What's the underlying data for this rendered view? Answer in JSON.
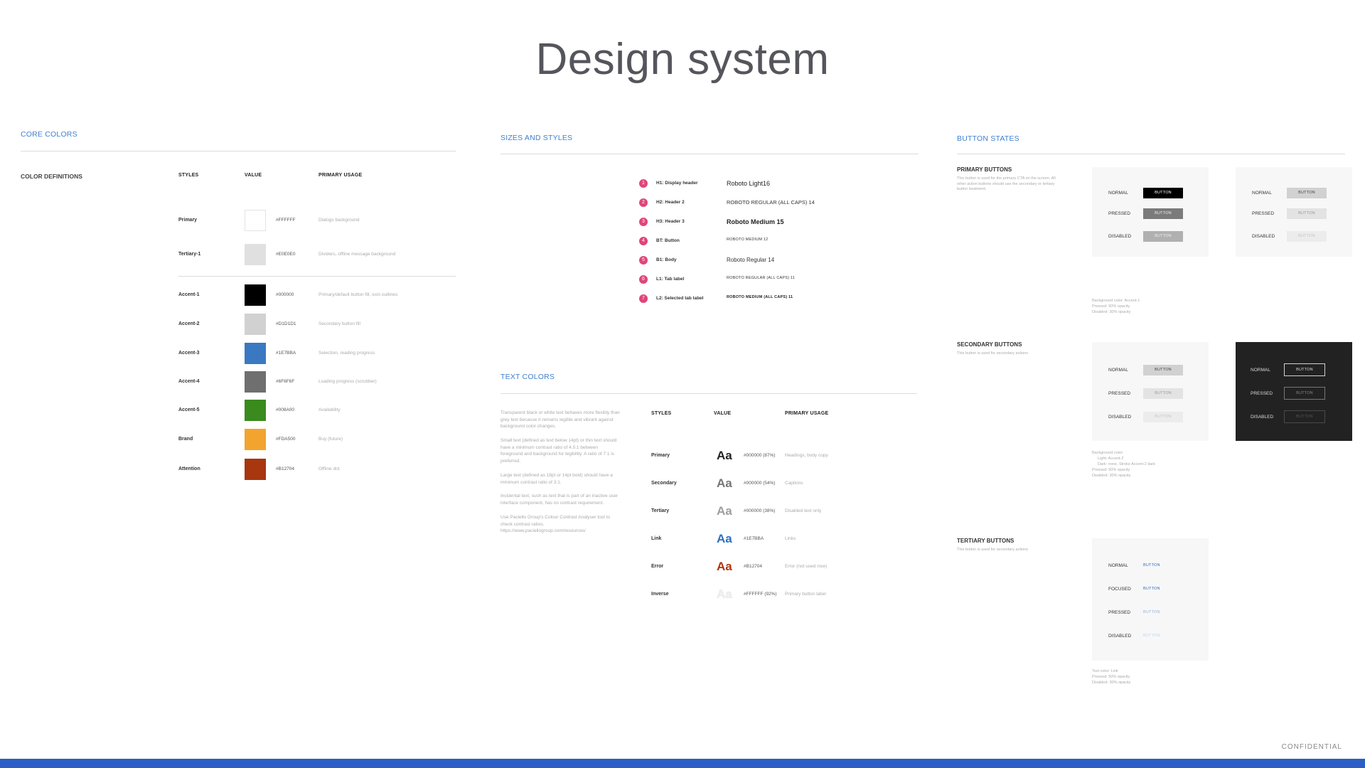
{
  "page_title": "Design system",
  "confidential": "CONFIDENTIAL",
  "core_colors": {
    "title": "CORE COLORS",
    "definitions_label": "COLOR DEFINITIONS",
    "headers": {
      "styles": "STYLES",
      "value": "VALUE",
      "usage": "PRIMARY USAGE"
    },
    "rows": [
      {
        "style": "Primary",
        "value": "#FFFFFF",
        "usage": "Dialogs background",
        "color": "#FFFFFF"
      },
      {
        "style": "Tertiary-1",
        "value": "#E0E0E0",
        "usage": "Dividers, offline message background",
        "color": "#E0E0E0"
      },
      {
        "style": "Accent-1",
        "value": "#000000",
        "usage": "Primary/default button fill, icon outlines",
        "color": "#000000"
      },
      {
        "style": "Accent-2",
        "value": "#D1D1D1",
        "usage": "Secondary button fill",
        "color": "#D1D1D1"
      },
      {
        "style": "Accent-3",
        "value": "#1E7BBA",
        "usage": "Selection, reading progress",
        "color": "#3B78C2"
      },
      {
        "style": "Accent-4",
        "value": "#6F6F6F",
        "usage": "Loading progress (scrubber)",
        "color": "#6F6F6F"
      },
      {
        "style": "Accent-5",
        "value": "#008A00",
        "usage": "Availability",
        "color": "#3A8A1E"
      },
      {
        "style": "Brand",
        "value": "#FDA500",
        "usage": "Buy (future)",
        "color": "#F2A42E"
      },
      {
        "style": "Attention",
        "value": "#B12704",
        "usage": "Offline dot",
        "color": "#A8360F"
      }
    ]
  },
  "sizes_styles": {
    "title": "SIZES AND STYLES",
    "rows": [
      {
        "num": "1",
        "label": "H1: Display header",
        "sample": "Roboto Light16"
      },
      {
        "num": "2",
        "label": "H2: Header 2",
        "sample": "ROBOTO REGULAR (ALL CAPS) 14"
      },
      {
        "num": "3",
        "label": "H3: Header 3",
        "sample": "Roboto Medium 15"
      },
      {
        "num": "4",
        "label": "BT: Button",
        "sample": "ROBOTO MEDIUM 12"
      },
      {
        "num": "5",
        "label": "B1: Body",
        "sample": "Roboto Regular 14"
      },
      {
        "num": "6",
        "label": "L1: Tab label",
        "sample": "ROBOTO REGULAR (ALL CAPS) 11"
      },
      {
        "num": "7",
        "label": "L2: Selected tab label",
        "sample": "ROBOTO MEDIUM (ALL CAPS) 11"
      }
    ]
  },
  "text_colors": {
    "title": "TEXT COLORS",
    "headers": {
      "styles": "STYLES",
      "value": "VALUE",
      "usage": "PRIMARY USAGE"
    },
    "paragraphs": [
      "Transparent black or white text behaves more flexibly than grey text because it remains legible and vibrant against background color changes.",
      "Small text (defined as text below 14pt) or thin text should have a minimum contrast ratio of 4.5:1 between foreground and background for legibility. A ratio of 7:1 is preferred.",
      "Large text (defined as 18pt or 14pt bold) should have a minimum contrast ratio of 3:1.",
      "Incidental text, such as text that is part of an inactive user interface component, has no contrast requirement.",
      "Use Paciello Group's Colour Contrast Analyser tool to check contrast ratios. https://www.paciellogroup.com/resources/"
    ],
    "sample": "Aa",
    "rows": [
      {
        "style": "Primary",
        "value": "#000000 (87%)",
        "usage": "Headings, body copy",
        "color": "#222222"
      },
      {
        "style": "Secondary",
        "value": "#000000 (54%)",
        "usage": "Captions",
        "color": "#757575"
      },
      {
        "style": "Tertiary",
        "value": "#000000 (38%)",
        "usage": "Disabled text only",
        "color": "#9e9e9e"
      },
      {
        "style": "Link",
        "value": "#1E7BBA",
        "usage": "Links",
        "color": "#2c6fc0"
      },
      {
        "style": "Error",
        "value": "#B12704",
        "usage": "Error (not used now)",
        "color": "#b1330c"
      },
      {
        "style": "Inverse",
        "value": "#FFFFFF (92%)",
        "usage": "Primary button label",
        "color": "#eeeeee"
      }
    ]
  },
  "button_states": {
    "title": "BUTTON STATES",
    "button_label": "BUTTON",
    "states": {
      "normal": "NORMAL",
      "pressed": "PRESSED",
      "disabled": "DISABLED",
      "focused": "FOCUSED"
    },
    "primary": {
      "title": "PRIMARY BUTTONS",
      "desc": "This button is used for the primary CTA on the screen. All other action buttons should use the secondary or tertiary button treatment.",
      "note": [
        "Background color: Accent-1",
        "Pressed: 50% opacity",
        "Disabled: 30% opacity"
      ]
    },
    "secondary": {
      "title": "SECONDARY BUTTONS",
      "desc": "This button is used for secondary actions",
      "note": [
        "Background color:",
        "Light: Accent-2",
        "Dark: none. Stroke Accent-2 dark",
        "Pressed: 50% opacity",
        "Disabled: 30% opacity"
      ]
    },
    "tertiary": {
      "title": "TERTIARY BUTTONS",
      "desc": "This button is used for secondary actions",
      "note": [
        "Text color: Link",
        "Pressed: 50% opacity",
        "Disabled: 30% opacity"
      ]
    }
  }
}
